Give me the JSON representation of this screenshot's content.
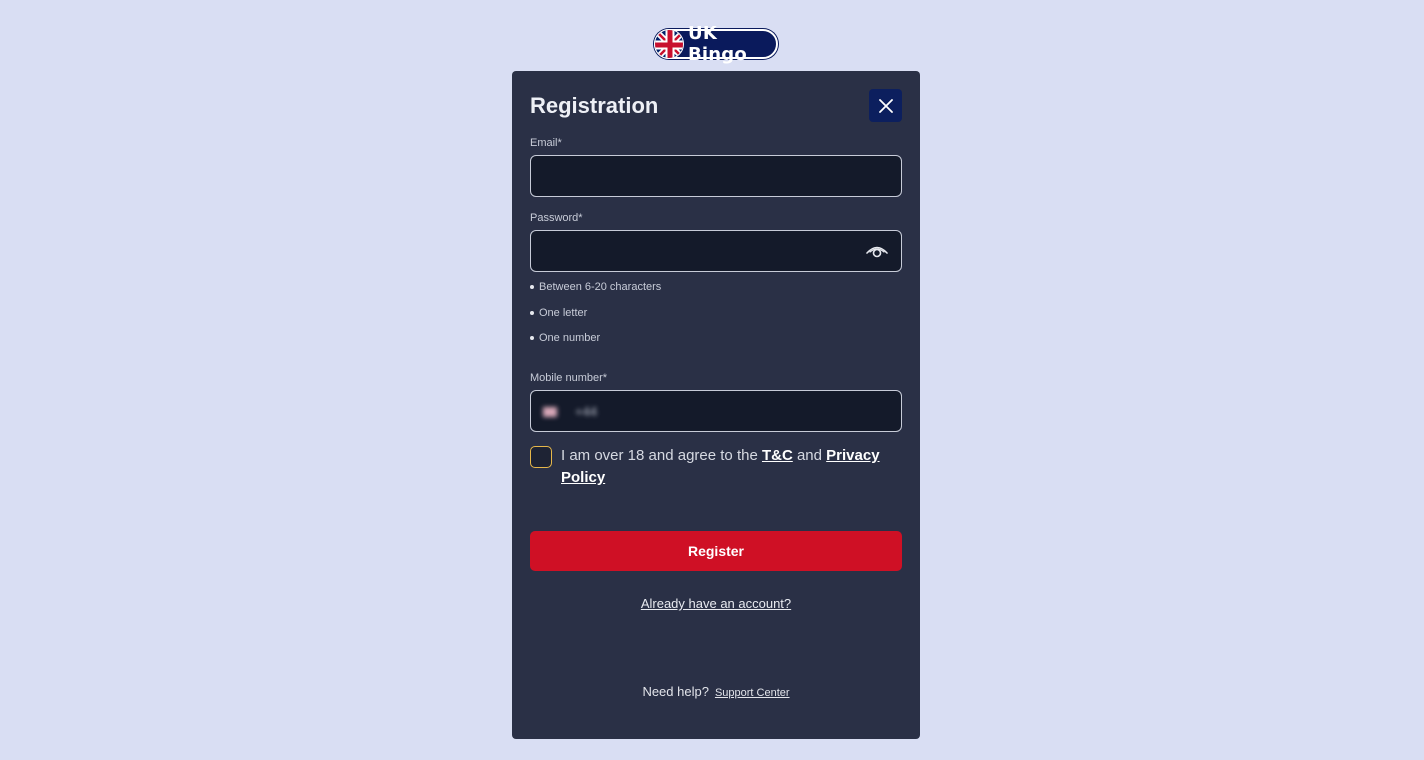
{
  "brand": {
    "logo_text": "UK Bingo",
    "logo_color": "#0a1a5c"
  },
  "modal": {
    "title": "Registration",
    "close_icon": "close-icon"
  },
  "email": {
    "label": "Email*",
    "value": "",
    "placeholder": ""
  },
  "password": {
    "label": "Password*",
    "value": "",
    "placeholder": "",
    "toggle_icon": "eye-icon",
    "rules": [
      "Between 6-20 characters",
      "One letter",
      "One number"
    ]
  },
  "mobile": {
    "label": "Mobile number*",
    "country_code": "+44",
    "flag_icon": "uk-flag-icon",
    "value": ""
  },
  "consent": {
    "checked": false,
    "text_before": "I am over 18 and agree to the ",
    "tc_link": "T&C",
    "text_middle": " and ",
    "privacy_link": "Privacy Policy"
  },
  "actions": {
    "register_label": "Register",
    "register_color": "#cf1025",
    "login_link": "Already have an account?"
  },
  "help": {
    "text": "Need help?",
    "link": "Support Center"
  }
}
